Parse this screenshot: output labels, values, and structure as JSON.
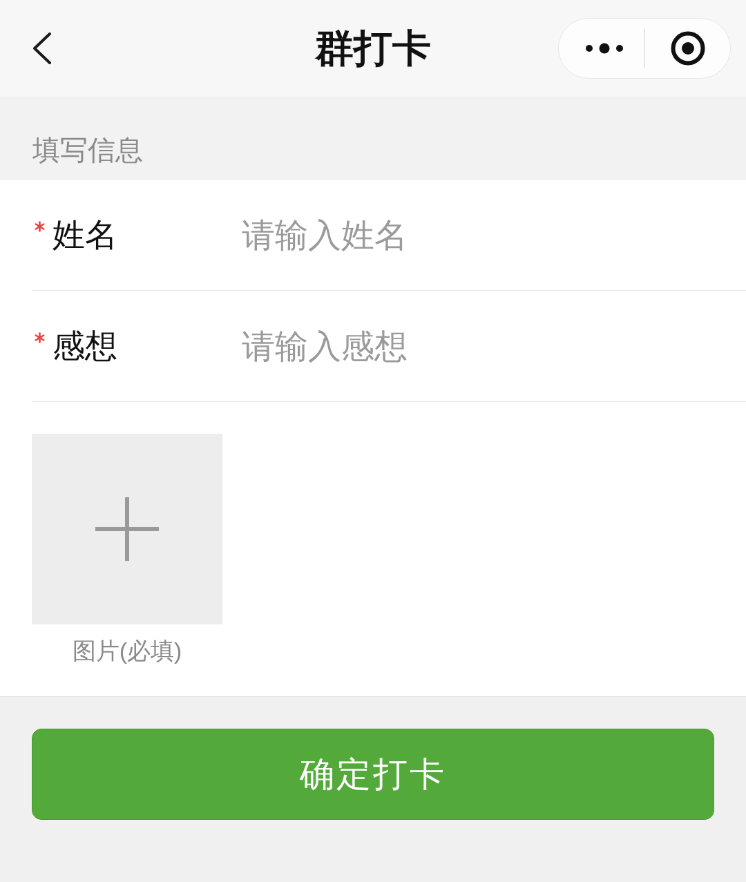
{
  "nav_bar": {
    "title": "群打卡"
  },
  "section": {
    "title": "填写信息"
  },
  "fields": [
    {
      "label": "姓名",
      "required": true,
      "placeholder": "请输入姓名"
    },
    {
      "label": "感想",
      "required": true,
      "placeholder": "请输入感想"
    }
  ],
  "upload": {
    "caption": "图片(必填)"
  },
  "submit_button": {
    "label": "确定打卡"
  }
}
